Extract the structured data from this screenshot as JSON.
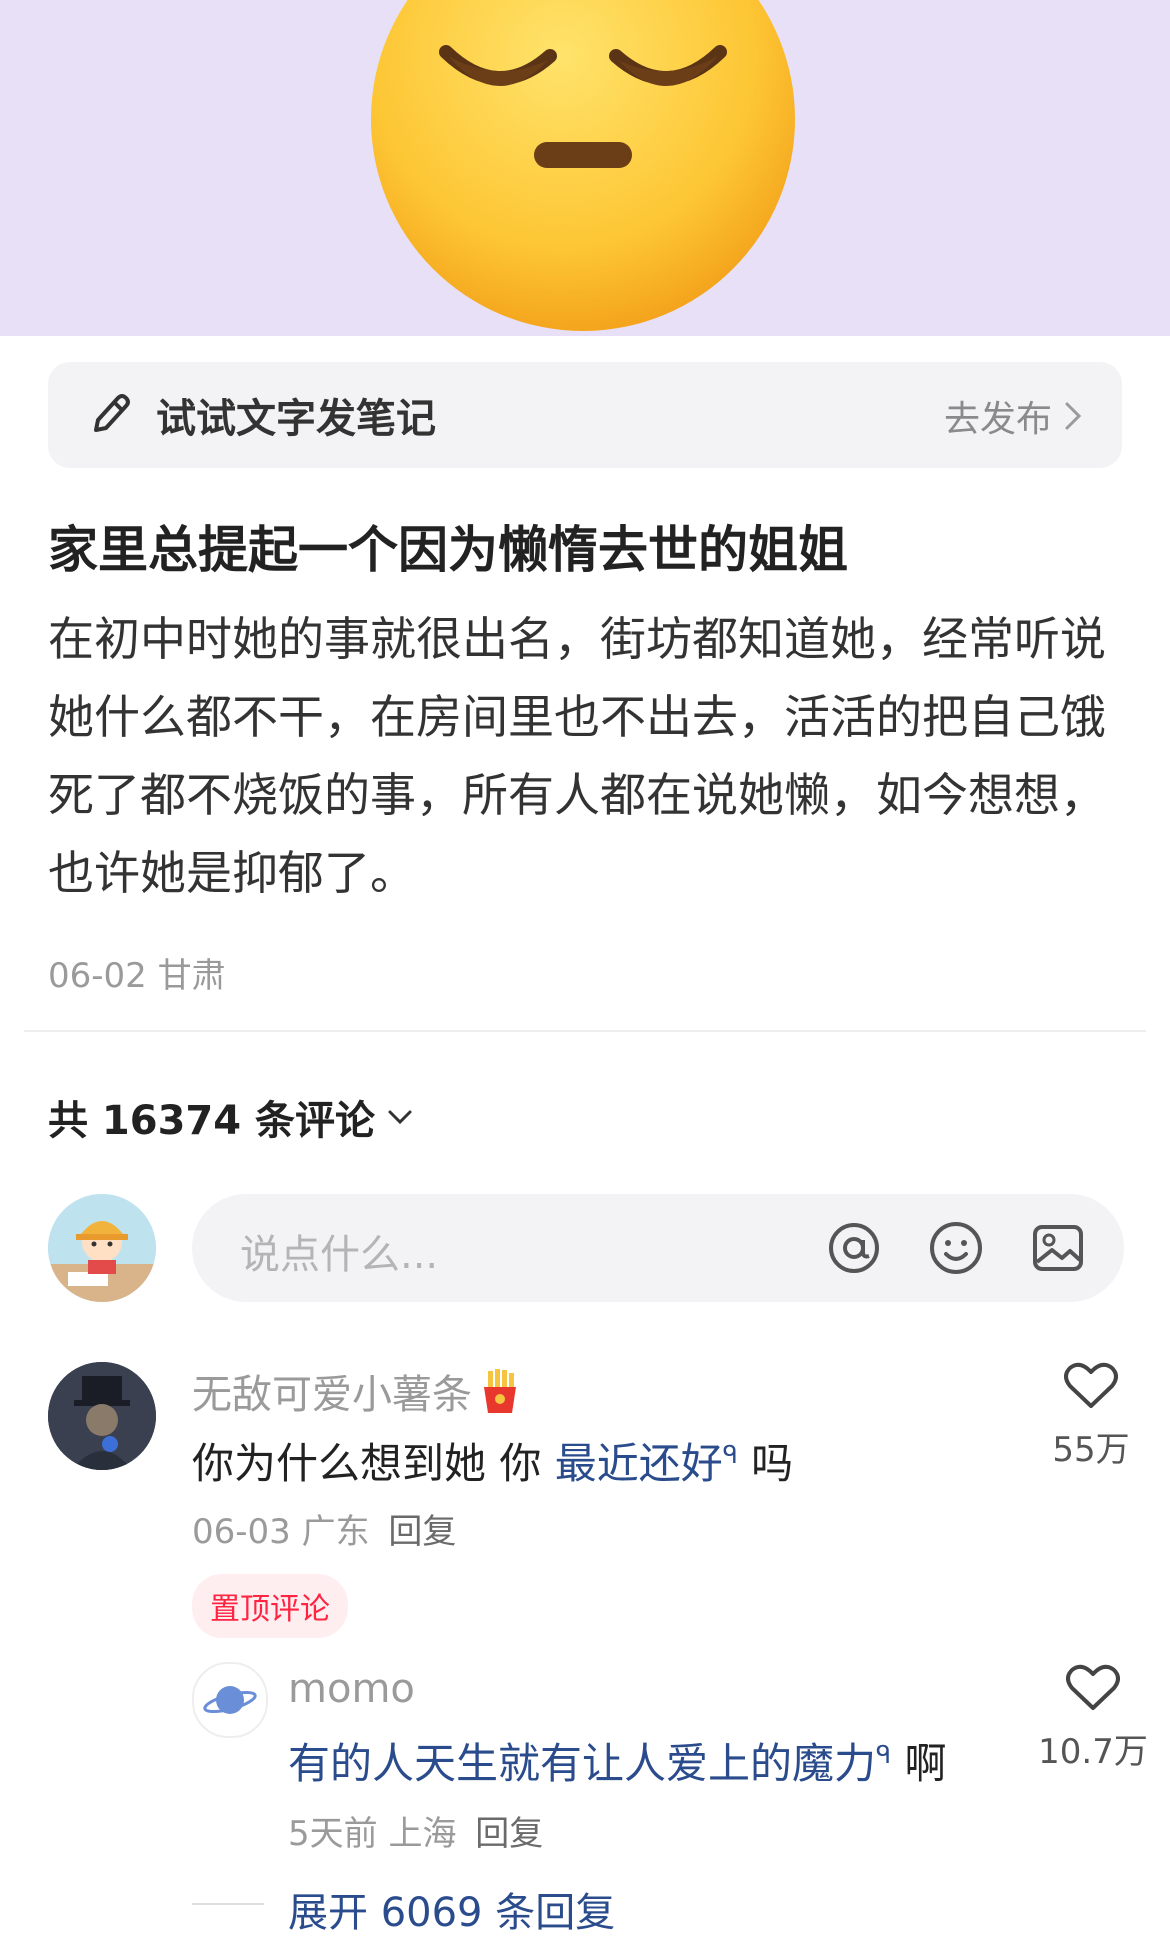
{
  "prompt_bar": {
    "label": "试试文字发笔记",
    "action": "去发布",
    "icon": "pen-icon"
  },
  "note": {
    "title": "家里总提起一个因为懒惰去世的姐姐",
    "body": "在初中时她的事就很出名，街坊都知道她，经常听说她什么都不干，在房间里也不出去，活活的把自己饿死了都不烧饭的事，所有人都在说她懒，如今想想，也许她是抑郁了。",
    "date": "06-02",
    "location": "甘肃"
  },
  "comments_header": {
    "count_label": "共 16374 条评论"
  },
  "comment_input": {
    "placeholder": "说点什么..."
  },
  "comment": {
    "username": "无敌可爱小薯条",
    "text_before": "你为什么想到她 你 ",
    "link": "最近还好",
    "text_after": " 吗",
    "date": "06-03",
    "location": "广东",
    "reply": "回复",
    "pin_tag": "置顶评论",
    "likes": "55万"
  },
  "reply": {
    "username": "momo",
    "link": "有的人天生就有让人爱上的魔力",
    "text_after": " 啊",
    "date": "5天前",
    "location": "上海",
    "reply": "回复",
    "likes": "10.7万",
    "expand": "展开 6069 条回复"
  },
  "colors": {
    "hero_bg": "#e8e0f7",
    "link": "#2b4c8c",
    "pin": "#ff2442"
  }
}
